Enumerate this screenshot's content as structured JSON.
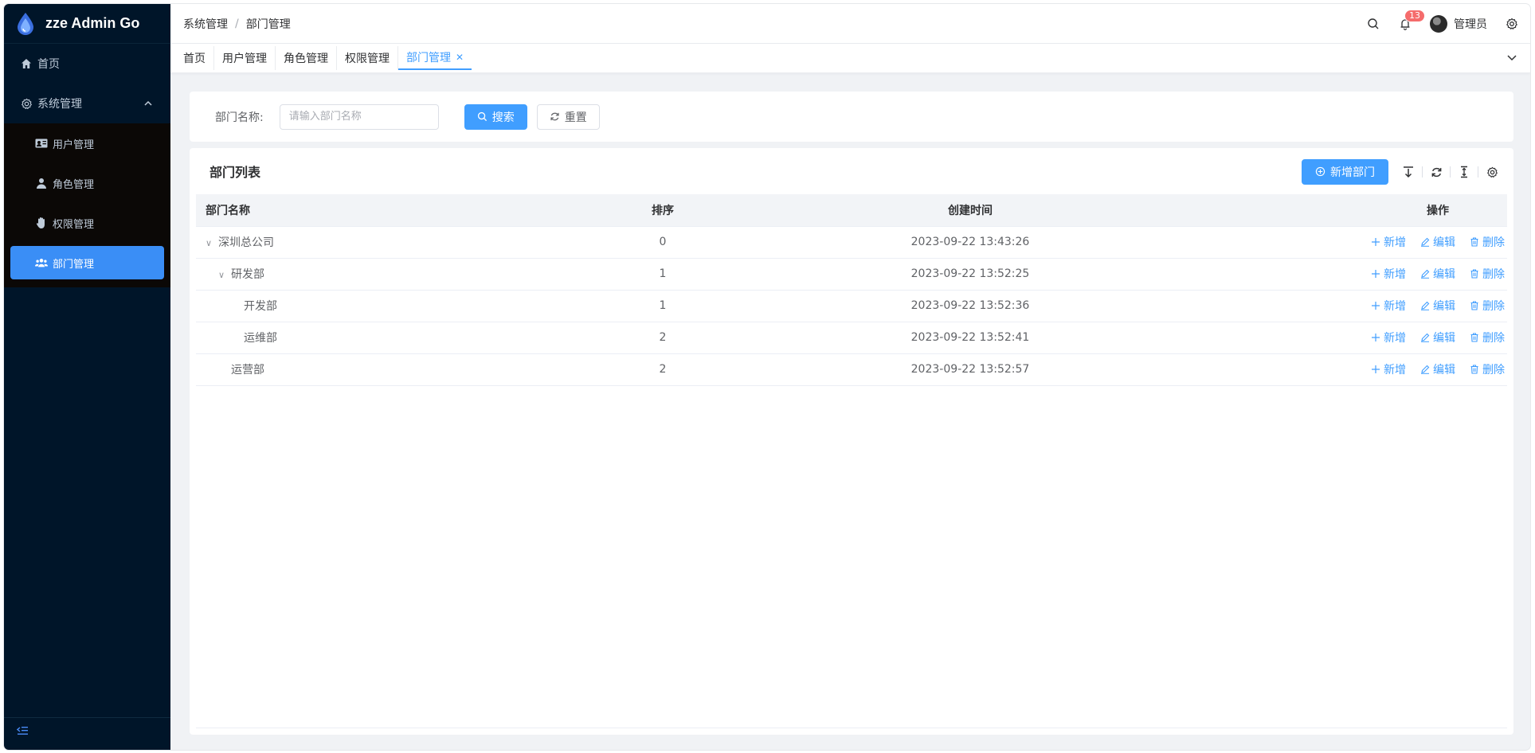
{
  "app": {
    "title": "zze Admin Go"
  },
  "sidebar": {
    "home": "首页",
    "system": "系统管理",
    "items": [
      {
        "label": "用户管理",
        "icon": "id-card-icon"
      },
      {
        "label": "角色管理",
        "icon": "user-icon"
      },
      {
        "label": "权限管理",
        "icon": "hand-icon"
      },
      {
        "label": "部门管理",
        "icon": "users-icon"
      }
    ],
    "active": "部门管理"
  },
  "header": {
    "breadcrumb": [
      "系统管理",
      "部门管理"
    ],
    "notification_count": "13",
    "user_name": "管理员"
  },
  "tabs": [
    {
      "label": "首页",
      "active": false
    },
    {
      "label": "用户管理",
      "active": false
    },
    {
      "label": "角色管理",
      "active": false
    },
    {
      "label": "权限管理",
      "active": false
    },
    {
      "label": "部门管理",
      "active": true
    }
  ],
  "search": {
    "label": "部门名称:",
    "placeholder": "请输入部门名称",
    "value": "",
    "search_button": "搜索",
    "reset_button": "重置"
  },
  "table": {
    "title": "部门列表",
    "add_button": "新增部门",
    "columns": [
      "部门名称",
      "排序",
      "创建时间",
      "操作"
    ],
    "rows": [
      {
        "name": "深圳总公司",
        "level": 0,
        "expandable": true,
        "sort": "0",
        "created": "2023-09-22 13:43:26"
      },
      {
        "name": "研发部",
        "level": 1,
        "expandable": true,
        "sort": "1",
        "created": "2023-09-22 13:52:25"
      },
      {
        "name": "开发部",
        "level": 2,
        "expandable": false,
        "sort": "1",
        "created": "2023-09-22 13:52:36"
      },
      {
        "name": "运维部",
        "level": 2,
        "expandable": false,
        "sort": "2",
        "created": "2023-09-22 13:52:41"
      },
      {
        "name": "运营部",
        "level": 1,
        "expandable": false,
        "sort": "2",
        "created": "2023-09-22 13:52:57"
      }
    ],
    "actions": {
      "add": "新增",
      "edit": "编辑",
      "delete": "删除"
    }
  },
  "colors": {
    "primary": "#409eff",
    "sidebar_bg": "#001529",
    "active_menu": "#3a8ef6",
    "badge": "#f56c6c"
  }
}
